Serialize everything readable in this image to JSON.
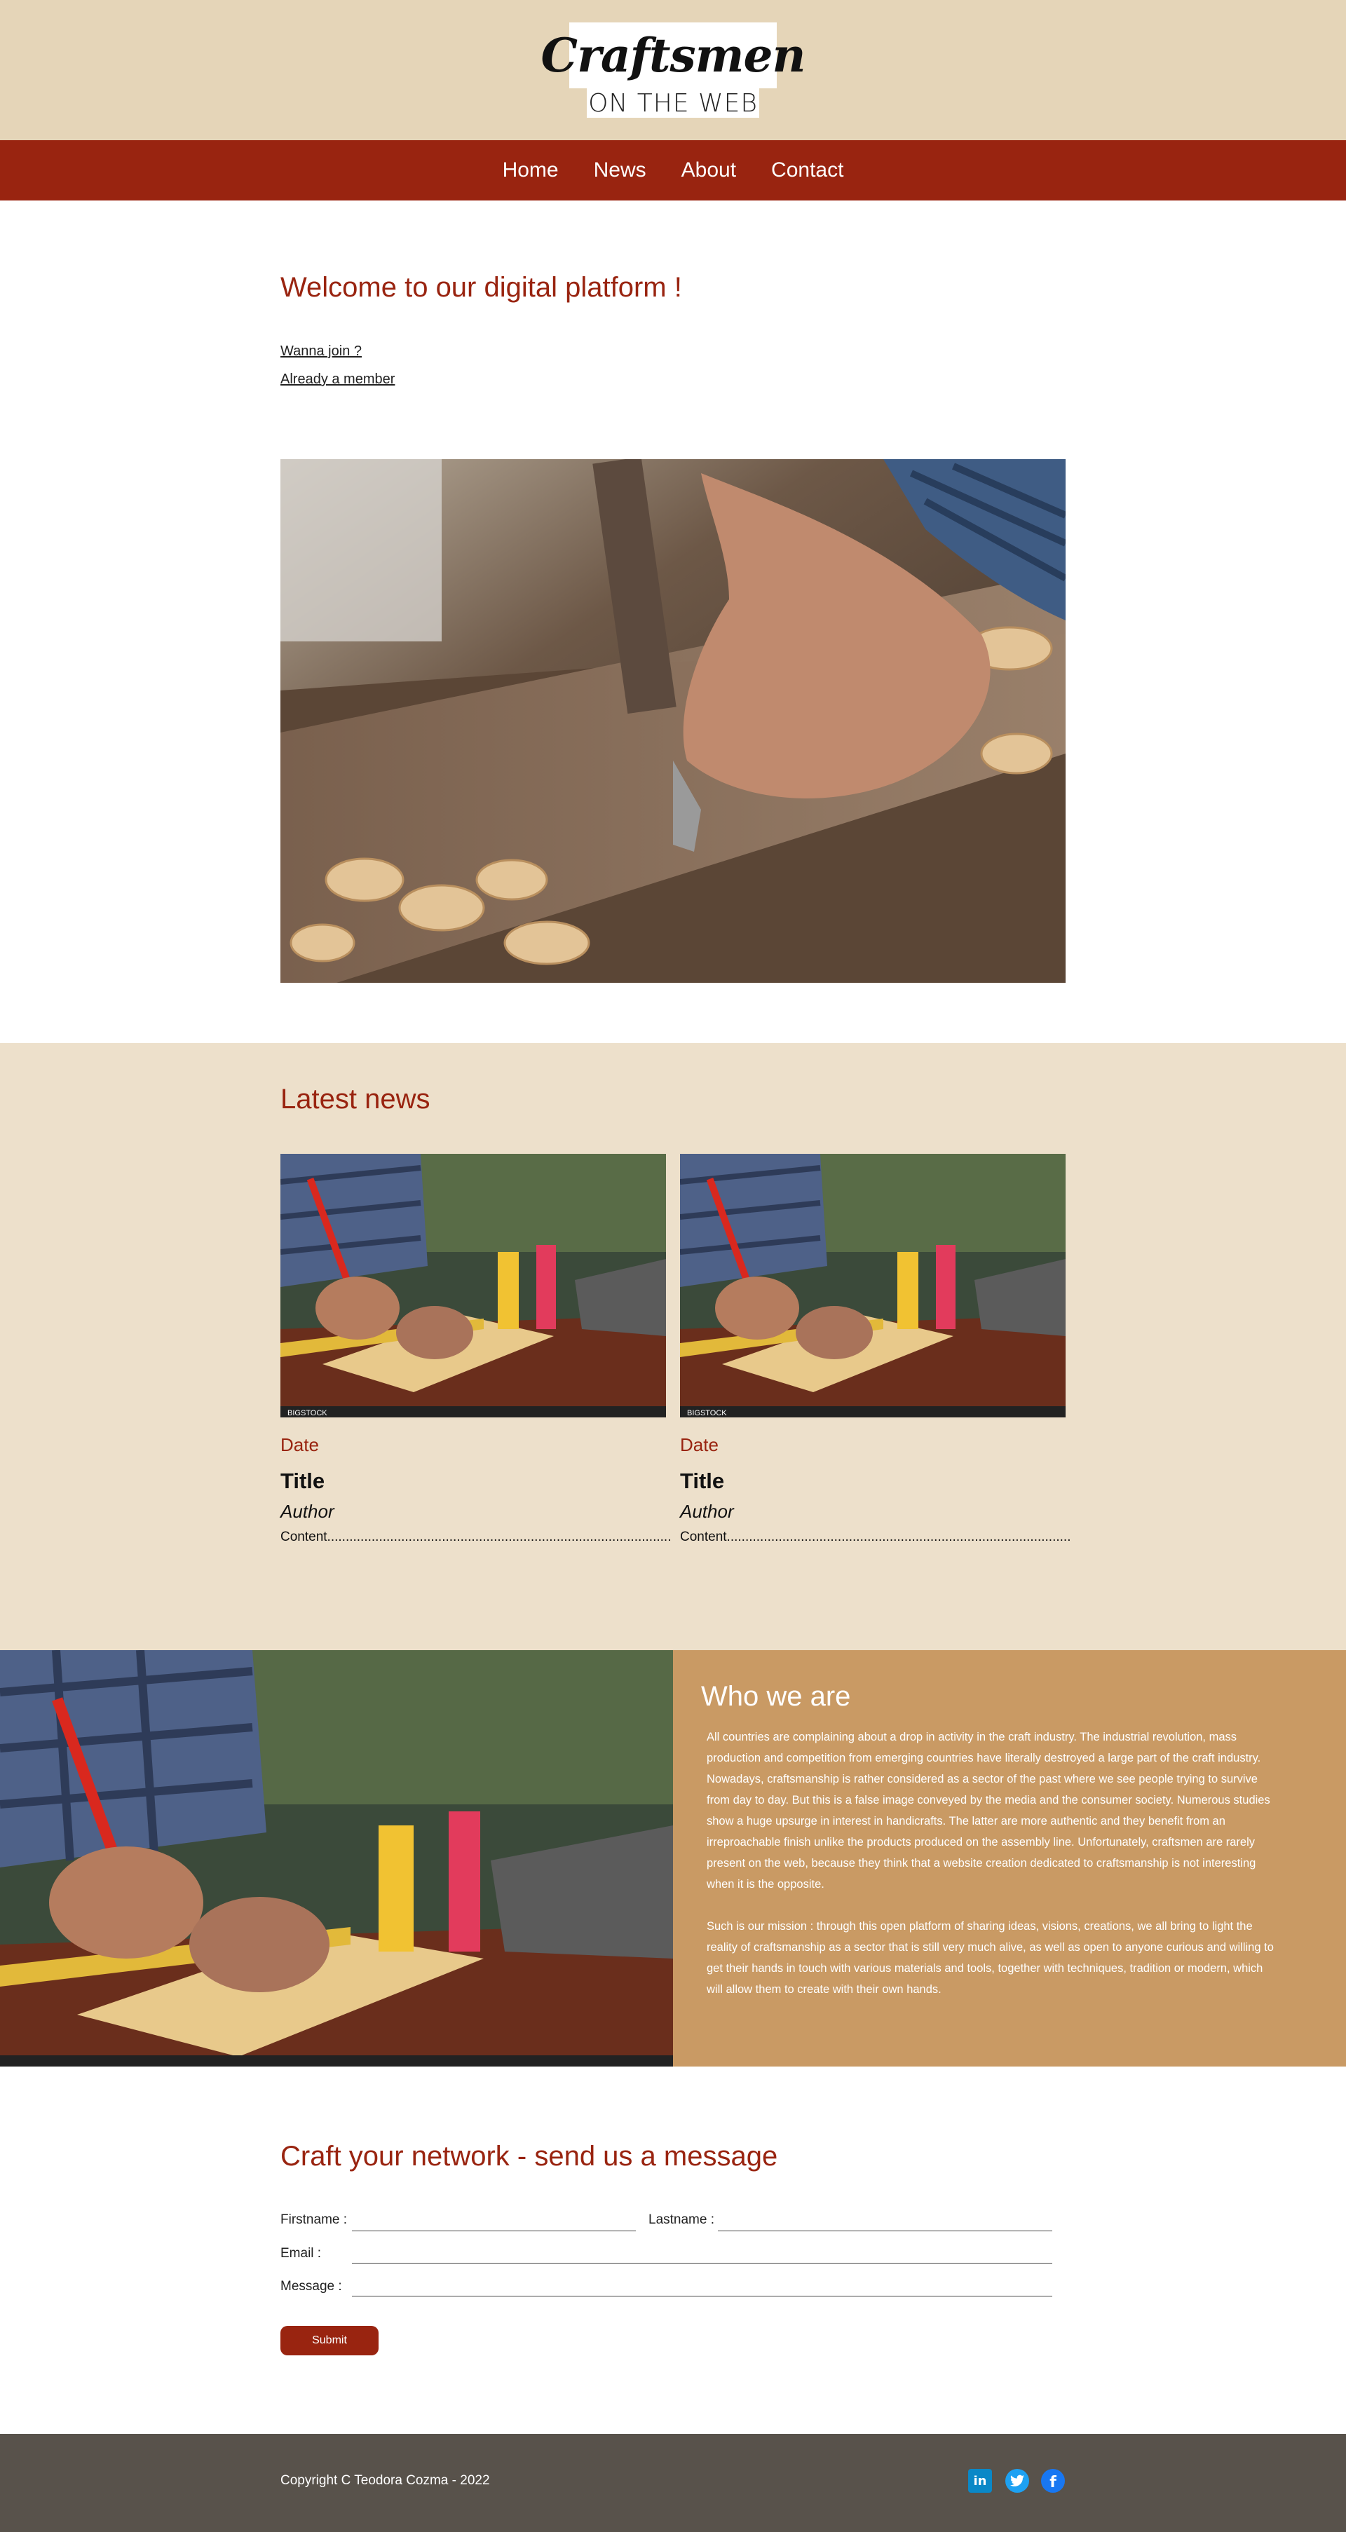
{
  "header": {
    "logo_line1": "Craftsmen",
    "logo_line2": "ON THE WEB"
  },
  "nav": {
    "items": [
      "Home",
      "News",
      "About",
      "Contact"
    ]
  },
  "welcome": {
    "title": "Welcome to our digital platform !",
    "join_link": "Wanna join ?",
    "member_link": "Already a member"
  },
  "news": {
    "title": "Latest news",
    "cards": [
      {
        "date": "Date",
        "title": "Title",
        "author": "Author",
        "content": "Content............................................................................................."
      },
      {
        "date": "Date",
        "title": "Title",
        "author": "Author",
        "content": "Content............................................................................................."
      }
    ]
  },
  "about": {
    "title": "Who we are",
    "p1": "All countries are complaining about a drop in activity in the craft industry. The industrial revolution, mass production and competition from emerging countries have literally destroyed a large part of the craft industry. Nowadays, craftsmanship is rather considered as a sector of the past where we see people trying to survive from day to day. But this is a false image conveyed by the media and the consumer society. Numerous studies show a huge upsurge in interest in handicrafts. The latter are more authentic and they benefit from an irreproachable finish unlike the products produced on the assembly line. Unfortunately, craftsmen are rarely present on the web, because they think that a website creation dedicated to craftsmanship is not interesting when it is the opposite.",
    "p2": "Such is our mission : through this open platform of sharing ideas, visions, creations, we all bring to light the reality of craftsmanship as a sector that is still very much alive, as well as open to anyone curious and willing to get their hands in touch with various materials and tools, together with techniques, tradition or modern, which will allow them to create with their own hands."
  },
  "contact": {
    "title": "Craft your network - send us a message",
    "firstname_label": "Firstname :",
    "lastname_label": "Lastname :",
    "email_label": "Email :",
    "message_label": "Message :",
    "submit_label": "Submit"
  },
  "footer": {
    "copyright": "Copyright C Teodora Cozma - 2022",
    "social": [
      "linkedin-icon",
      "twitter-icon",
      "facebook-icon"
    ]
  },
  "colors": {
    "brand_red": "#992410",
    "beige": "#e5d5b8",
    "news_bg": "#ede0cb",
    "about_bg": "#c99a64",
    "footer_bg": "#58524b"
  }
}
